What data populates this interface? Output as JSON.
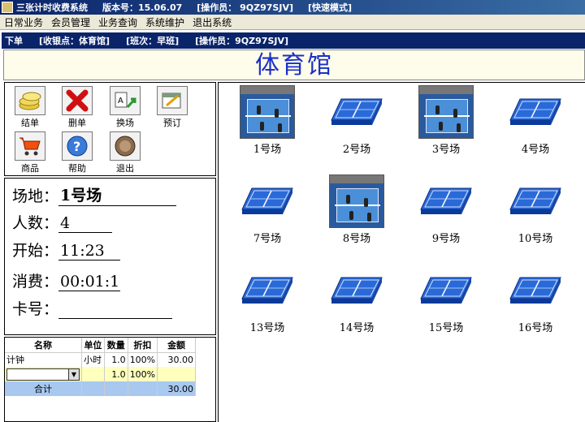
{
  "title": {
    "app": "三张计时收费系统",
    "version": "版本号：15.06.07",
    "operator": "[操作员： 9QZ97SJV]",
    "mode": "[快速模式]"
  },
  "menu": [
    "日常业务",
    "会员管理",
    "业务查询",
    "系统维护",
    "退出系统"
  ],
  "status": {
    "mode": "下单",
    "point": "[收银点：体育馆]",
    "shift": "[班次：早班]",
    "operator": "[操作员：9QZ97SJV]"
  },
  "venue": "体育馆",
  "tools": [
    {
      "name": "checkout",
      "label": "结单",
      "icon": "coins-icon"
    },
    {
      "name": "delete",
      "label": "删单",
      "icon": "red-x-icon"
    },
    {
      "name": "swap",
      "label": "换场",
      "icon": "swap-icon"
    },
    {
      "name": "reserve",
      "label": "预订",
      "icon": "reserve-icon"
    },
    {
      "name": "goods",
      "label": "商品",
      "icon": "cart-icon"
    },
    {
      "name": "help",
      "label": "帮助",
      "icon": "help-icon"
    },
    {
      "name": "exit",
      "label": "退出",
      "icon": "exit-icon"
    }
  ],
  "info": {
    "venue_label": "场地：",
    "venue_value": "1号场",
    "people_label": "人数：",
    "people_value": "4",
    "start_label": "开始：",
    "start_value": "11:23",
    "cost_label": "消费：",
    "cost_value": "00:01:1",
    "card_label": "卡号：",
    "card_value": ""
  },
  "orders": {
    "headers": [
      "名称",
      "单位",
      "数量",
      "折扣",
      "金额"
    ],
    "rows": [
      {
        "name": "计钟",
        "unit": "小时",
        "qty": "1.0",
        "discount": "100%",
        "amount": "30.00"
      },
      {
        "name": "",
        "unit": "",
        "qty": "1.0",
        "discount": "100%",
        "amount": ""
      }
    ],
    "total_label": "合计",
    "total_amount": "30.00"
  },
  "courts": [
    {
      "label": "1号场",
      "occupied": true
    },
    {
      "label": "2号场",
      "occupied": false
    },
    {
      "label": "3号场",
      "occupied": true
    },
    {
      "label": "4号场",
      "occupied": false
    },
    {
      "label": "7号场",
      "occupied": false
    },
    {
      "label": "8号场",
      "occupied": true
    },
    {
      "label": "9号场",
      "occupied": false
    },
    {
      "label": "10号场",
      "occupied": false
    },
    {
      "label": "13号场",
      "occupied": false
    },
    {
      "label": "14号场",
      "occupied": false
    },
    {
      "label": "15号场",
      "occupied": false
    },
    {
      "label": "16号场",
      "occupied": false
    }
  ],
  "colors": {
    "accent": "#0a246a",
    "venue_text": "#1a2fc8",
    "court_blue": "#2a6ad8",
    "edit_row": "#ffffbe",
    "total_row": "#a8c8f0"
  }
}
